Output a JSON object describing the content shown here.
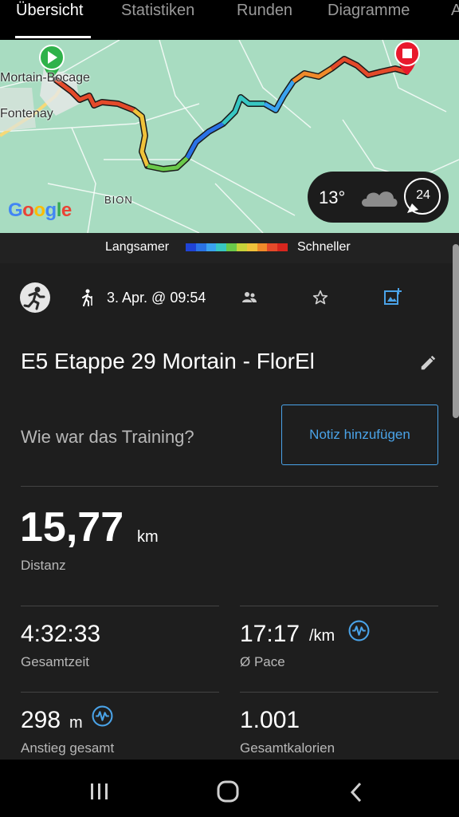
{
  "tabs": [
    "Übersicht",
    "Statistiken",
    "Runden",
    "Diagramme",
    "A"
  ],
  "map": {
    "labels": {
      "town1": "Mortain-Bocage",
      "town2": "Fontenay",
      "place": "BION"
    },
    "attribution": "Google",
    "weather": {
      "temperature": "13°",
      "wind_speed": "24"
    }
  },
  "speed_scale": {
    "slower_label": "Langsamer",
    "faster_label": "Schneller",
    "colors": [
      "#1f43d6",
      "#2a73e6",
      "#3aa3f0",
      "#38c7c2",
      "#6ac94a",
      "#c7d33a",
      "#f0c23a",
      "#f08a2a",
      "#e44a2a",
      "#d7261e"
    ]
  },
  "activity": {
    "datetime": "3. Apr. @ 09:54",
    "title": "E5 Etappe 29 Mortain - FlorEl",
    "question": "Wie war das Training?",
    "note_button": "Notiz hinzufügen"
  },
  "stats": {
    "distance": {
      "value": "15,77",
      "unit": "km",
      "label": "Distanz"
    },
    "total_time": {
      "value": "4:32:33",
      "label": "Gesamtzeit"
    },
    "pace": {
      "value": "17:17",
      "unit": "/km",
      "label": "Ø Pace"
    },
    "ascent": {
      "value": "298",
      "unit": "m",
      "label": "Anstieg gesamt"
    },
    "calories": {
      "value": "1.001",
      "label": "Gesamtkalorien"
    }
  },
  "colors": {
    "accent": "#4aa3e8",
    "start_marker": "#2fb24a",
    "end_marker": "#e8192c"
  }
}
